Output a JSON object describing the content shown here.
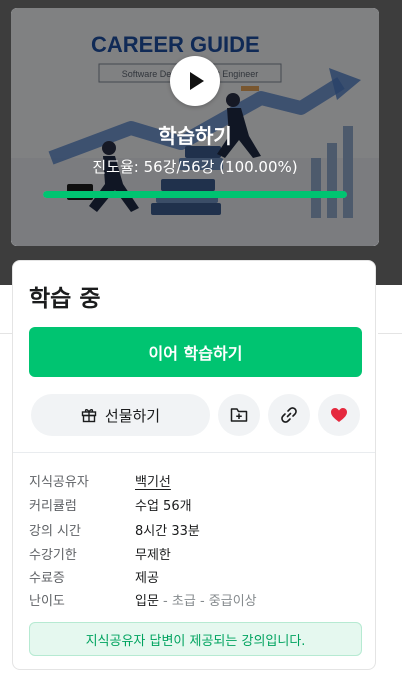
{
  "hero": {
    "logo_title": "CAREER GUIDE",
    "logo_subtitle": "Software Developer/Test Engineer",
    "overlay_title": "학습하기",
    "progress_text": "진도율: 56강/56강 (100.00%)",
    "progress_fraction": 1.0,
    "accent_color": "#00c471"
  },
  "card": {
    "status_title": "학습 중",
    "primary_button": "이어 학습하기",
    "gift_button": "선물하기",
    "icons": [
      "gift-icon",
      "add-folder-icon",
      "link-icon",
      "heart-icon"
    ],
    "info": [
      {
        "label": "지식공유자",
        "value": "백기선"
      },
      {
        "label": "커리큘럼",
        "value": "수업 56개"
      },
      {
        "label": "강의 시간",
        "value": "8시간 33분"
      },
      {
        "label": "수강기한",
        "value": "무제한"
      },
      {
        "label": "수료증",
        "value": "제공"
      },
      {
        "label": "난이도",
        "levels": [
          "입문",
          "초급",
          "중급이상"
        ],
        "separator": " - "
      }
    ],
    "notice": "지식공유자 답변이 제공되는 강의입니다."
  }
}
